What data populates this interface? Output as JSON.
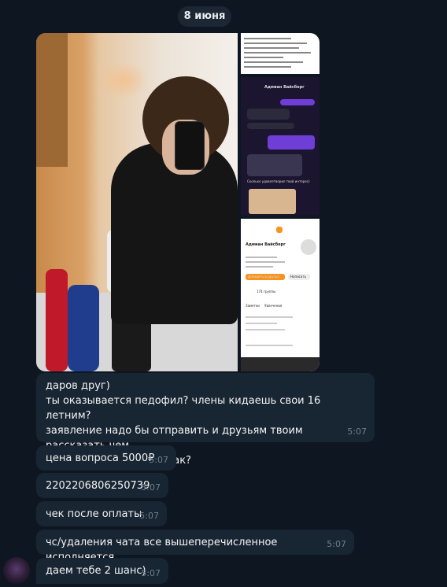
{
  "date_separator": "8 июня",
  "album": {
    "thumb_profile": {
      "name": "Адмиан Вайсберг",
      "tab_posts": "Заметки",
      "tab_groups": "Увлечения",
      "groups_count": "174 группы",
      "add_friend": "Добавить в друзья",
      "write": "Написать"
    },
    "thumb_chat": {
      "contact": "Адмиан Вайсберг",
      "caption": "Сколько удовлетворил твой интерес)"
    }
  },
  "messages": [
    {
      "text": "даров друг)\nты оказывается педофил? члены кидаешь свои 16 летним?\nзаявление надо бы отправить и друзьям твоим рассказать чем\nты занимаешься ведь так?",
      "time": "5:07"
    },
    {
      "text": "цена вопроса 5000₽",
      "time": "5:07"
    },
    {
      "text": "2202206806250739",
      "time": "5:07"
    },
    {
      "text": "чек после оплаты",
      "time": "5:07"
    },
    {
      "text": "чс/удаления чата все вышеперечисленное исполняется",
      "time": "5:07"
    },
    {
      "text": "даем тебе 2 шанс)",
      "time": "5:07"
    }
  ],
  "colors": {
    "background": "#0e1621",
    "bubble": "#182533",
    "time_text": "#6d7f8f"
  }
}
